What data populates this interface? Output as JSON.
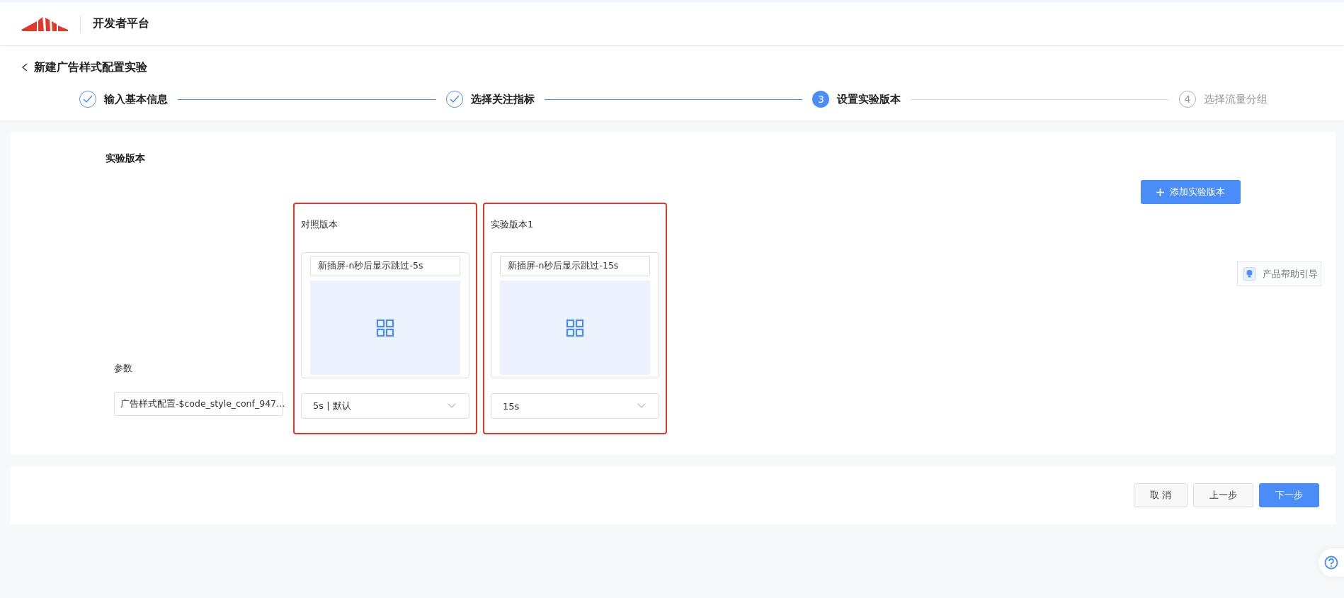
{
  "header": {
    "title": "开发者平台"
  },
  "page_title": "新建广告样式配置实验",
  "steps": [
    {
      "label": "输入基本信息",
      "completed": true,
      "selected": false
    },
    {
      "label": "选择关注指标",
      "completed": true,
      "selected": false
    },
    {
      "number": "3",
      "label": "设置实验版本",
      "completed": false,
      "selected": true
    },
    {
      "number": "4",
      "label": "选择流量分组",
      "completed": false,
      "selected": false
    }
  ],
  "section": {
    "title": "实验版本",
    "add_button": "添加实验版本"
  },
  "parameter": {
    "label": "参数",
    "value": "广告样式配置-$code_style_conf_947…"
  },
  "versions": [
    {
      "title": "对照版本",
      "style_name": "新插屏-n秒后显示跳过-5s",
      "value": "5s | 默认",
      "highlighted": true
    },
    {
      "title": "实验版本1",
      "style_name": "新插屏-n秒后显示跳过-15s",
      "value": "15s",
      "highlighted": true
    }
  ],
  "help_guide": "产品帮助引导",
  "footer_buttons": [
    {
      "label": "取 消",
      "kind": "default"
    },
    {
      "label": "上一步",
      "kind": "default"
    },
    {
      "label": "下一步",
      "kind": "primary"
    }
  ]
}
